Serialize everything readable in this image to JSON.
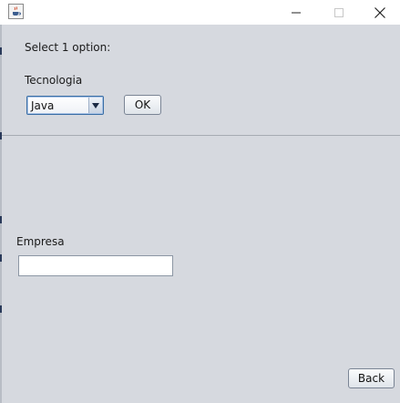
{
  "window": {
    "icon": "java-cup-icon",
    "controls": [
      "minimize-icon",
      "maximize-icon",
      "close-icon"
    ]
  },
  "prompt": {
    "text": "Select 1 option:"
  },
  "tecnologia": {
    "label": "Tecnologia",
    "selected": "Java",
    "ok_label": "OK"
  },
  "empresa": {
    "label": "Empresa",
    "value": ""
  },
  "footer": {
    "back_label": "Back"
  }
}
